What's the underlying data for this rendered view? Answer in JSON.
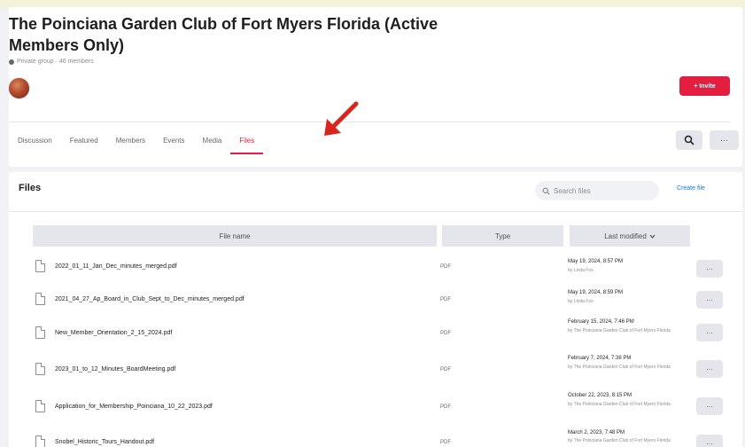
{
  "group": {
    "title": "The Poinciana Garden Club of Fort Myers Florida (Active Members Only)",
    "meta": "Private group · 46 members",
    "invite_label": "+ Invite"
  },
  "tabs": [
    {
      "label": "Discussion"
    },
    {
      "label": "Featured"
    },
    {
      "label": "Members"
    },
    {
      "label": "Events"
    },
    {
      "label": "Media"
    },
    {
      "label": "Files"
    }
  ],
  "tab_more_label": "···",
  "files": {
    "title": "Files",
    "search_placeholder": "Search files",
    "create_label": "Create file",
    "columns": {
      "name": "File name",
      "type": "Type",
      "modified": "Last modified"
    },
    "rows": [
      {
        "name": "2022_01_11_Jan_Dec_minutes_merged.pdf",
        "type": "PDF",
        "date": "May 19, 2024, 8:57 PM",
        "by": "by Linda Fox"
      },
      {
        "name": "2021_04_27_Ap_Board_in_Club_Sept_to_Dec_minutes_merged.pdf",
        "type": "PDF",
        "date": "May 19, 2024, 8:59 PM",
        "by": "by Linda Fox"
      },
      {
        "name": "New_Member_Orientation_2_15_2024.pdf",
        "type": "PDF",
        "date": "February 15, 2024, 7:46 PM",
        "by": "by The Poinciana Garden Club of Fort Myers Florida"
      },
      {
        "name": "2023_01_to_12_Minutes_BoardMeeting.pdf",
        "type": "PDF",
        "date": "February 7, 2024, 7:38 PM",
        "by": "by The Poinciana Garden Club of Fort Myers Florida"
      },
      {
        "name": "Application_for_Membership_Poinciana_10_22_2023.pdf",
        "type": "PDF",
        "date": "October 22, 2023, 8:15 PM",
        "by": "by The Poinciana Garden Club of Fort Myers Florida"
      },
      {
        "name": "Snobel_Historic_Tours_Handout.pdf",
        "type": "PDF",
        "date": "March 2, 2023, 7:48 PM",
        "by": "by The Poinciana Garden Club of Fort Myers Florida"
      }
    ],
    "row_more_label": "···"
  }
}
